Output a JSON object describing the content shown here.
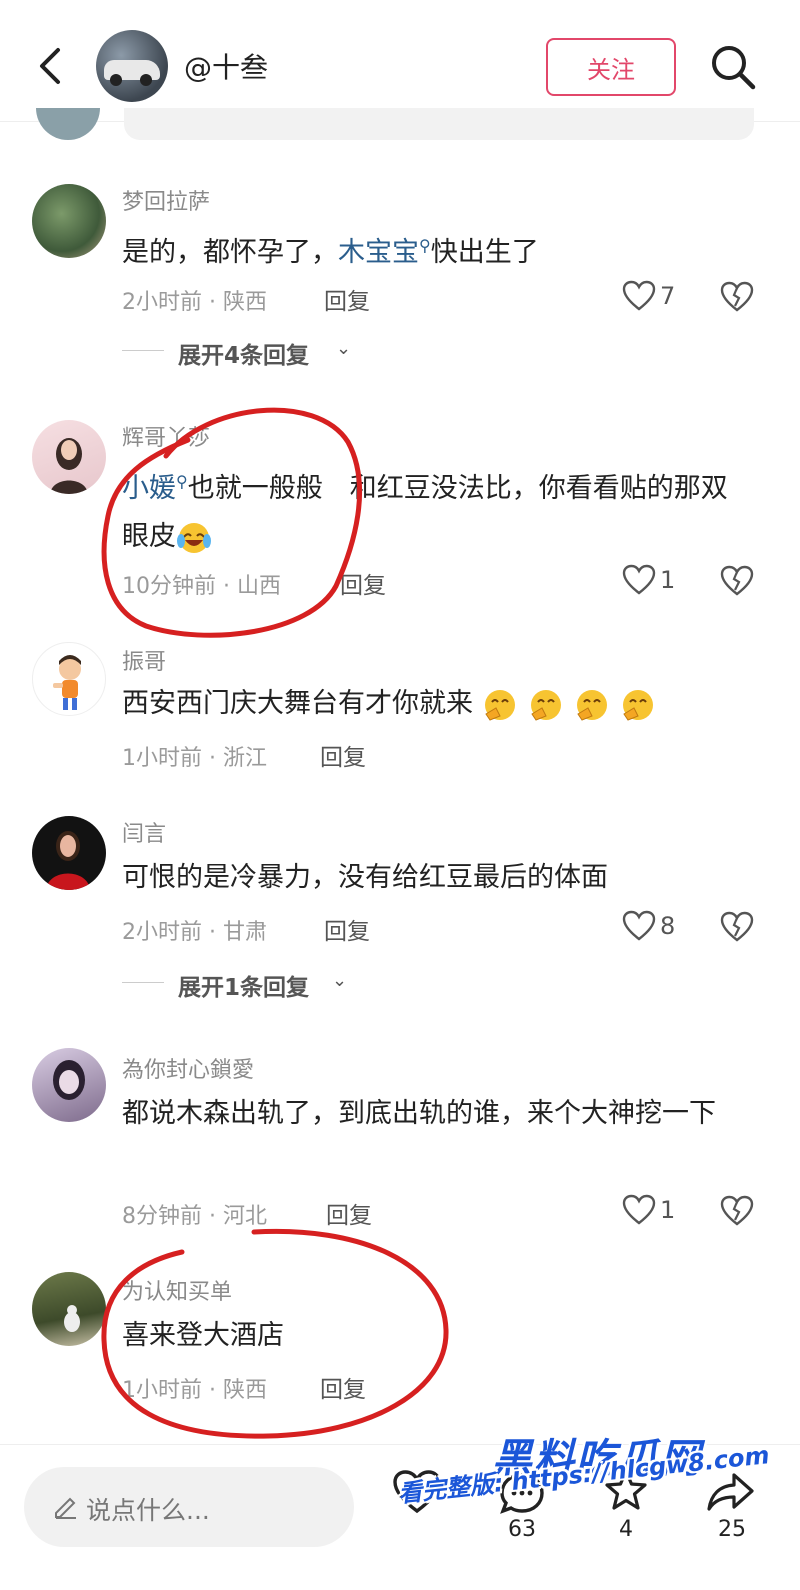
{
  "header": {
    "account_name": "@十叁",
    "follow_label": "关注",
    "icons": {
      "back": "back-arrow-icon",
      "search": "search-icon"
    }
  },
  "comments": [
    {
      "username": "梦回拉萨",
      "text_before": "是的，都怀孕了，",
      "mention": "木宝宝",
      "text_after": "快出生了",
      "meta": "2小时前 · 陕西",
      "reply_label": "回复",
      "likes": "7",
      "expand": "展开4条回复"
    },
    {
      "username": "辉哥丫莎",
      "mention": "小媛",
      "text_after": "也就一般般　和红豆没法比，你看看贴的那双眼皮",
      "emoji": "laugh-cry-emoji",
      "meta": "10分钟前 · 山西",
      "reply_label": "回复",
      "likes": "1"
    },
    {
      "username": "振哥",
      "text": "西安西门庆大舞台有才你就来",
      "emoji": "clapping-emoji",
      "meta": "1小时前 · 浙江",
      "reply_label": "回复"
    },
    {
      "username": "闫言",
      "text": "可恨的是冷暴力，没有给红豆最后的体面",
      "meta": "2小时前 · 甘肃",
      "reply_label": "回复",
      "likes": "8",
      "expand": "展开1条回复"
    },
    {
      "username": "為你封心鎖愛",
      "text": "都说木森出轨了，到底出轨的谁，来个大神挖一下",
      "meta": "8分钟前 · 河北",
      "reply_label": "回复",
      "likes": "1"
    },
    {
      "username": "为认知买单",
      "text": "喜来登大酒店",
      "meta": "1小时前 · 陕西",
      "reply_label": "回复"
    }
  ],
  "bottom_bar": {
    "input_placeholder": "说点什么...",
    "comments_count": "63",
    "favorites_count": "4",
    "shares_count": "25"
  },
  "watermark": {
    "title": "黑料吃瓜网",
    "url": "看完整版: https://hlcgw8.com"
  },
  "colors": {
    "accent": "#e2476a",
    "mention": "#2a5d8c",
    "annotation_red": "#d62020",
    "watermark": "#1b56d8"
  }
}
